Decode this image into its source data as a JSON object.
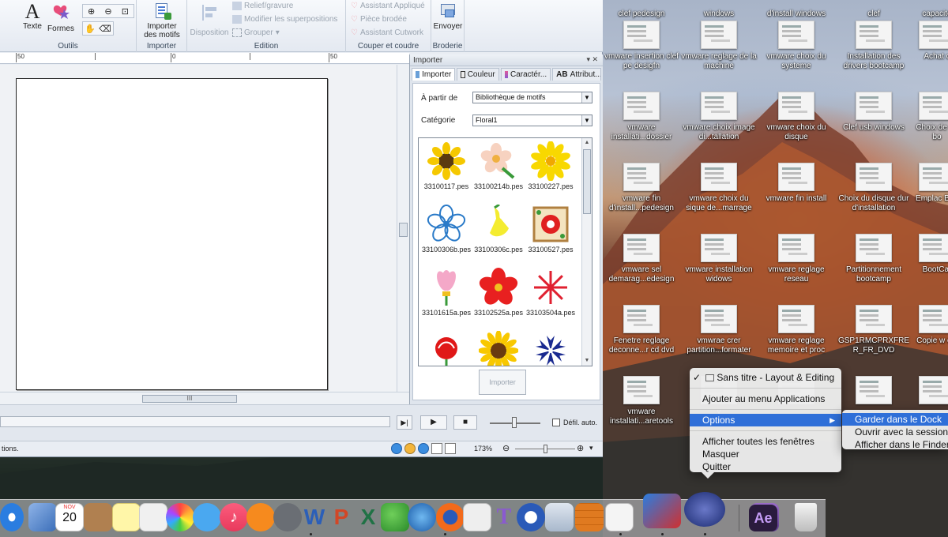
{
  "ribbon": {
    "text_label": "Texte",
    "shapes_label": "Formes",
    "tools_group": "Outils",
    "import_motifs_label": "Importer des motifs",
    "import_group": "Importer",
    "layout_label": "Disposition",
    "relief_label": "Relief/gravure",
    "modify_overlap_label": "Modifier les superpositions",
    "group_label": "Grouper",
    "edition_group": "Edition",
    "applique_label": "Assistant Appliqué",
    "embroidered_piece_label": "Pièce brodée",
    "cutwork_label": "Assistant Cutwork",
    "cut_sew_group": "Couper et coudre",
    "send_label": "Envoyer",
    "embroidery_group": "Broderie"
  },
  "ruler": {
    "labels": [
      "50",
      "0",
      "50",
      "50"
    ]
  },
  "panel": {
    "title": "Importer",
    "controls": "▾ ✕",
    "tabs": [
      "Importer",
      "Couleur",
      "Caractér...",
      "Attribut..."
    ],
    "from_label": "À partir de",
    "from_value": "Bibliothèque de motifs",
    "category_label": "Catégorie",
    "category_value": "Floral1",
    "import_button": "Importer",
    "files": [
      "33100117.pes",
      "33100214b.pes",
      "33100227.pes",
      "33100306b.pes",
      "33100306c.pes",
      "33100527.pes",
      "33101615a.pes",
      "33102525a.pes",
      "33103504a.pes",
      "",
      "",
      ""
    ]
  },
  "playbar": {
    "auto_scroll_label": "Défil. auto."
  },
  "statusbar": {
    "left_text": "tions.",
    "zoom": "173%"
  },
  "hscroll_grip": "III",
  "desktop_icons": [
    {
      "label": "clef pedesign"
    },
    {
      "label": "windows"
    },
    {
      "label": "d'install windows"
    },
    {
      "label": "clef"
    },
    {
      "label": "capacité"
    },
    {
      "label": "vmware insertion clef pe desigfn"
    },
    {
      "label": "vmware reglage de la machine"
    },
    {
      "label": "vmware choix du systeme"
    },
    {
      "label": "Installation des drivers bootcamp"
    },
    {
      "label": "Achat c"
    },
    {
      "label": "vmware installati...dossier"
    },
    {
      "label": "vmware choix image di...tallation"
    },
    {
      "label": "vmware choix du disque"
    },
    {
      "label": "Clef usb windows"
    },
    {
      "label": "Choix de de bo"
    },
    {
      "label": "vmware fin d'install...pedesign"
    },
    {
      "label": "vmware choix du sique de...marrage"
    },
    {
      "label": "vmware fin install"
    },
    {
      "label": "Choix du disque dur d'installation"
    },
    {
      "label": "Emplac Boo"
    },
    {
      "label": "vmware sel demarag...edesign"
    },
    {
      "label": "vmware installation widows"
    },
    {
      "label": "vmware reglage reseau"
    },
    {
      "label": "Partitionnement bootcamp"
    },
    {
      "label": "BootCar"
    },
    {
      "label": "Fenetre reglage deconne...r cd dvd"
    },
    {
      "label": "vmwrae crer partition...formater"
    },
    {
      "label": "vmware reglage memoire et proc"
    },
    {
      "label": "GSP1RMCPRXFRE R_FR_DVD"
    },
    {
      "label": "Copie w cle"
    },
    {
      "label": "vmware installati...aretools"
    },
    {
      "label": "v"
    },
    {
      "label": ""
    },
    {
      "label": ""
    },
    {
      "label": ""
    }
  ],
  "context_menu": {
    "item_window": "Sans titre - Layout & Editing",
    "add_to_apps": "Ajouter au menu Applications",
    "options": "Options",
    "show_all": "Afficher toutes les fenêtres",
    "hide": "Masquer",
    "quit": "Quitter",
    "check_mark": "✓",
    "submenu_arrow": "▶"
  },
  "submenu": {
    "keep_in_dock": "Garder dans le Dock",
    "open_at_login": "Ouvrir avec la session",
    "show_in_finder": "Afficher dans le Finder"
  },
  "dock": {
    "calendar_month": "NOV",
    "calendar_day": "20",
    "word_letter": "W",
    "ppt_letter": "P",
    "excel_letter": "X",
    "ae_label": "Ae"
  },
  "colors": {
    "menu_highlight": "#2f6fd8",
    "ribbon_bg": "#e4e9f1",
    "panel_bg": "#dfe5ed"
  }
}
